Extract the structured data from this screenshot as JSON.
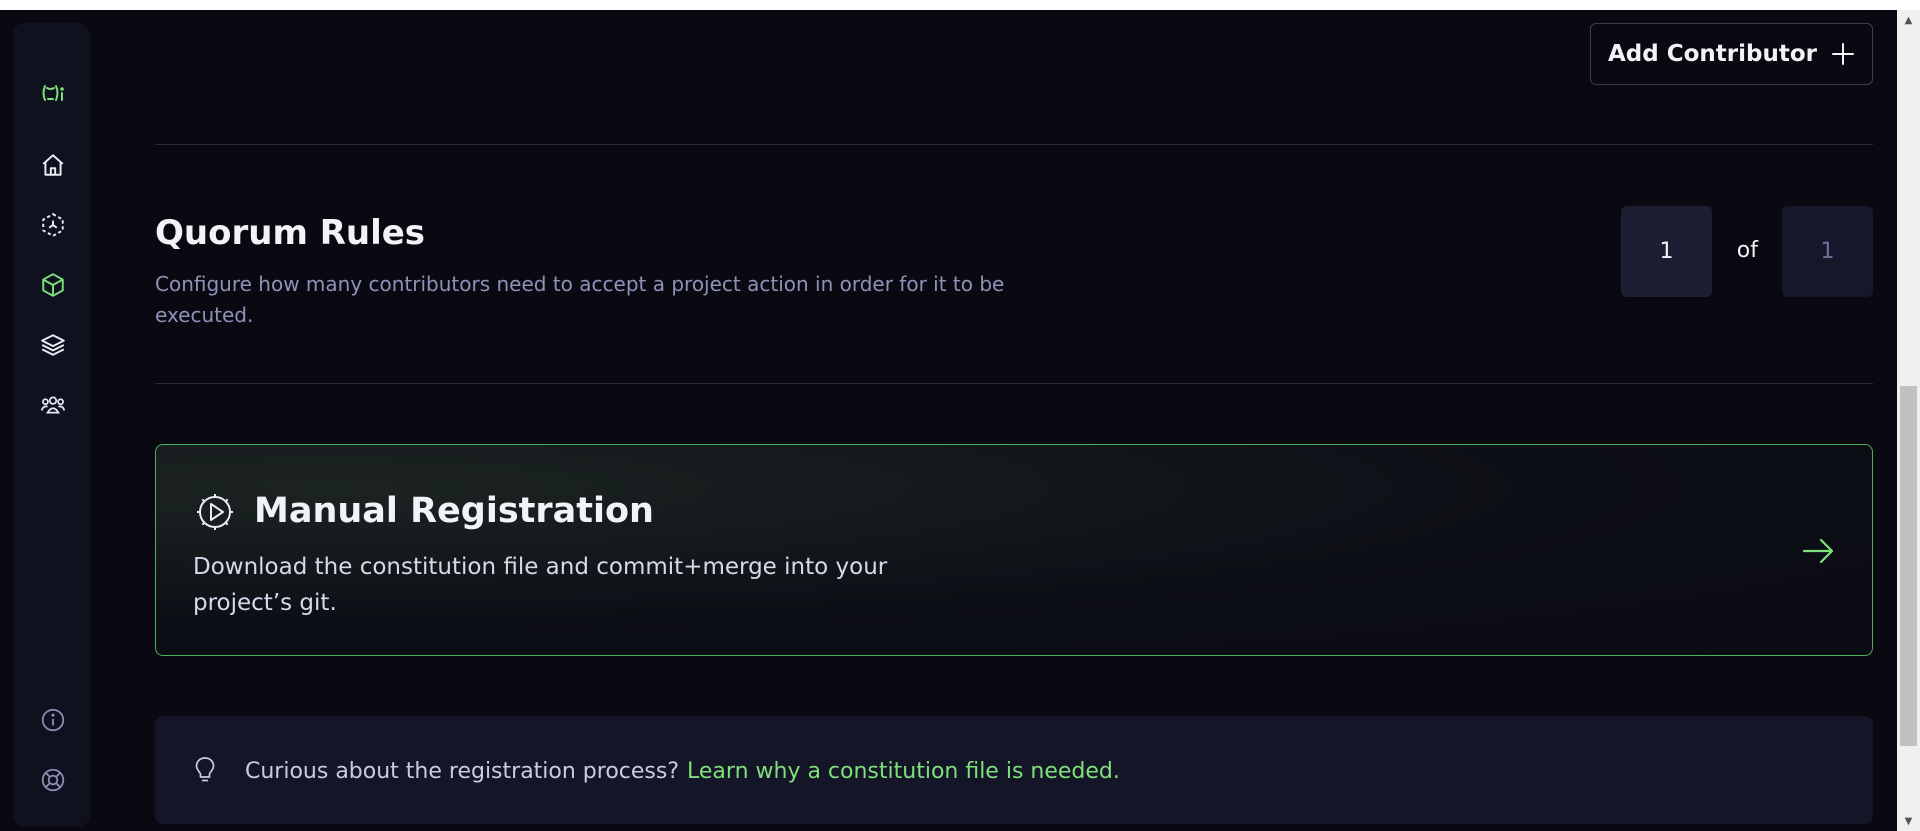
{
  "header": {
    "add_contributor_label": "Add Contributor"
  },
  "sidebar": {
    "items": [
      {
        "name": "logo",
        "label": "(ᵕ)i"
      },
      {
        "name": "home"
      },
      {
        "name": "network"
      },
      {
        "name": "projects"
      },
      {
        "name": "layers"
      },
      {
        "name": "users"
      },
      {
        "name": "info"
      },
      {
        "name": "help"
      }
    ]
  },
  "quorum": {
    "title": "Quorum Rules",
    "description": "Configure how many contributors need to accept a project action in order for it to be executed.",
    "required": "1",
    "of_label": "of",
    "total": "1"
  },
  "manual_registration": {
    "title": "Manual Registration",
    "description": "Download the constitution file and commit+merge into your project’s git."
  },
  "tip": {
    "text": "Curious about the registration process?",
    "link_text": "Learn why a constitution file is needed."
  },
  "colors": {
    "accent": "#7ee07a",
    "background": "#0a0912",
    "card_border": "#4bb05a"
  }
}
